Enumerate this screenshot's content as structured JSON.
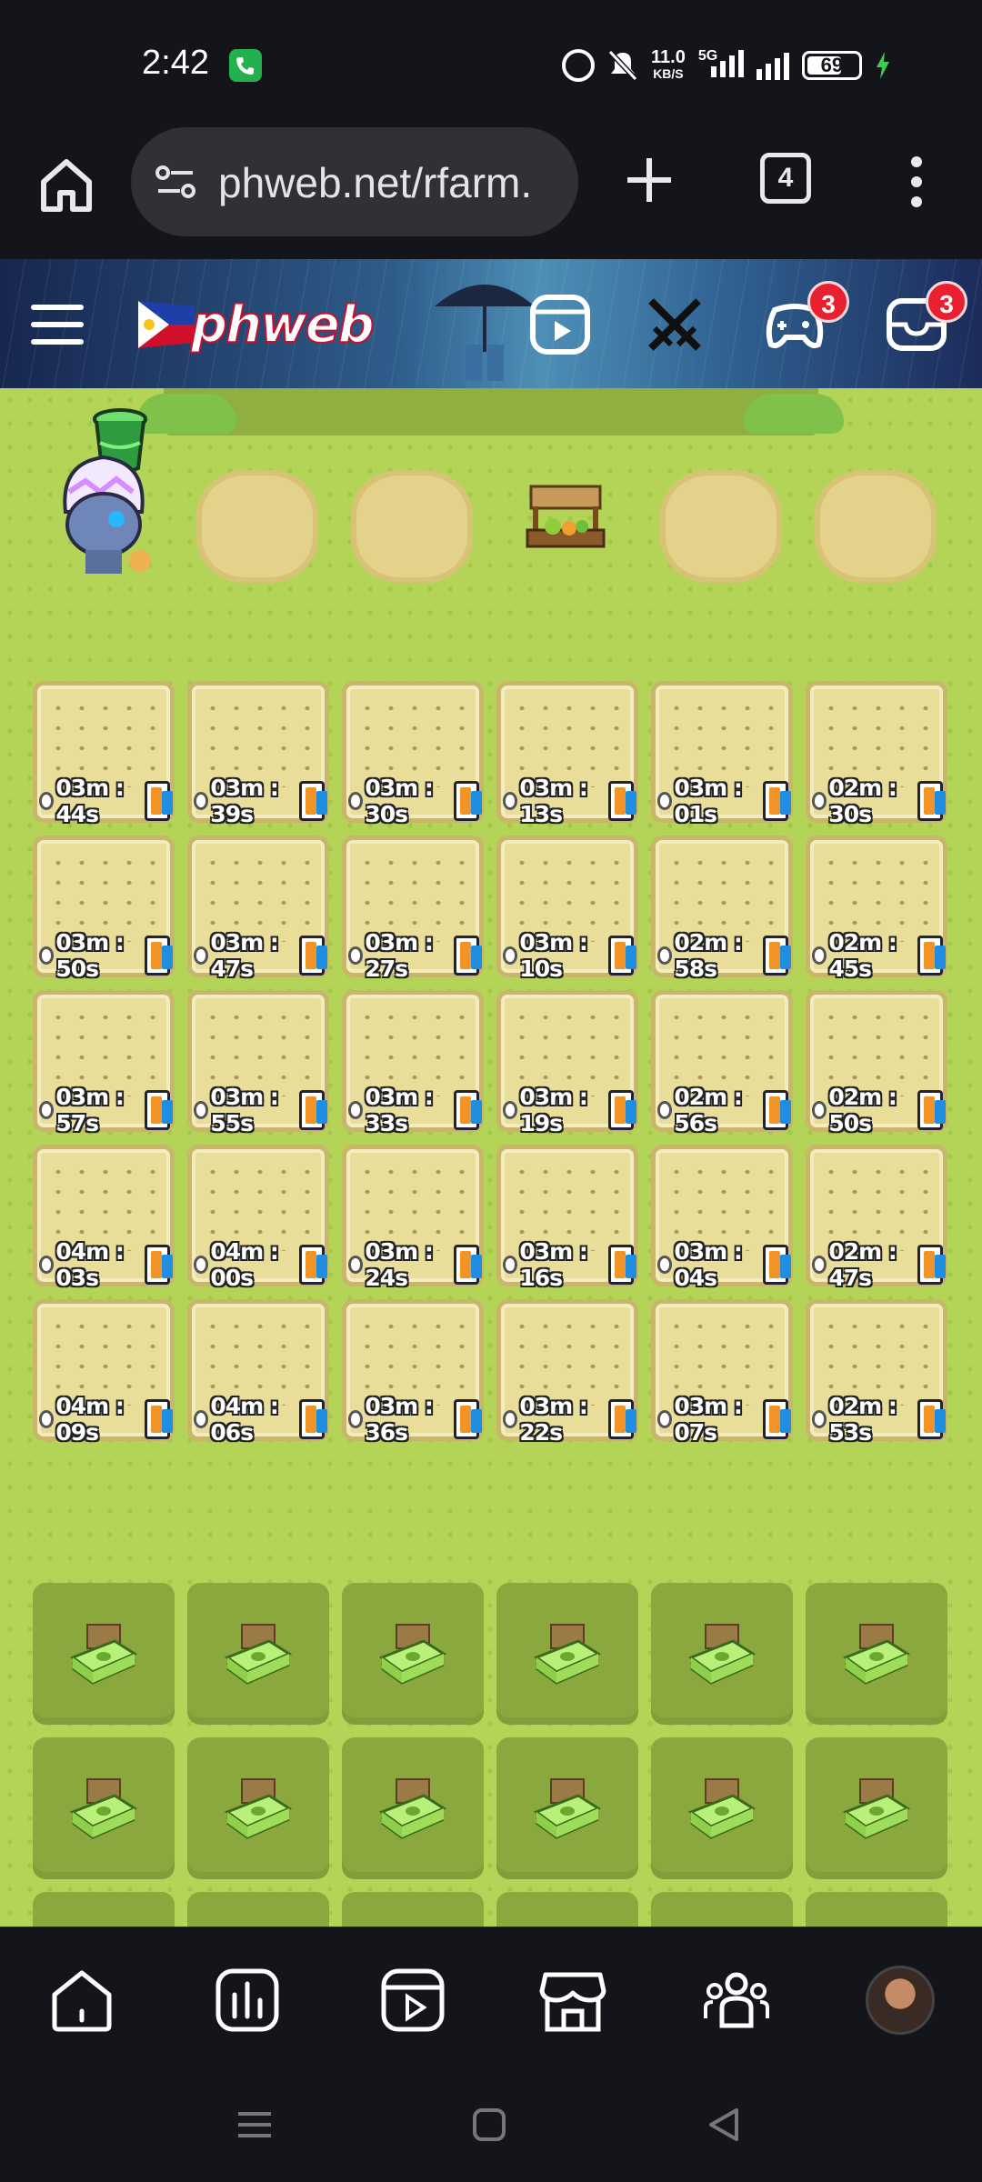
{
  "status_bar": {
    "time": "2:42",
    "net_speed_value": "11.0",
    "net_speed_unit": "KB/S",
    "network_type": "5G",
    "battery_level": "69",
    "battery_fraction": 0.69,
    "charging": true
  },
  "browser": {
    "url": "phweb.net/rfarm.",
    "tab_count": "4",
    "icons": [
      "home-icon",
      "site-settings-icon",
      "plus-icon",
      "tabs-icon",
      "more-vert-icon"
    ]
  },
  "site_header": {
    "logo_text": "phweb",
    "icons": [
      "hamburger-menu-icon",
      "video-reel-icon",
      "crossed-swords-icon",
      "gamepad-icon",
      "inbox-icon"
    ],
    "gamepad_badge": "3",
    "inbox_badge": "3"
  },
  "farm": {
    "active_plots": [
      {
        "timer": "03m : 44s"
      },
      {
        "timer": "03m : 39s"
      },
      {
        "timer": "03m : 30s"
      },
      {
        "timer": "03m : 13s"
      },
      {
        "timer": "03m : 01s"
      },
      {
        "timer": "02m : 30s"
      },
      {
        "timer": "03m : 50s"
      },
      {
        "timer": "03m : 47s"
      },
      {
        "timer": "03m : 27s"
      },
      {
        "timer": "03m : 10s"
      },
      {
        "timer": "02m : 58s"
      },
      {
        "timer": "02m : 45s"
      },
      {
        "timer": "03m : 57s"
      },
      {
        "timer": "03m : 55s"
      },
      {
        "timer": "03m : 33s"
      },
      {
        "timer": "03m : 19s"
      },
      {
        "timer": "02m : 56s"
      },
      {
        "timer": "02m : 50s"
      },
      {
        "timer": "04m : 03s"
      },
      {
        "timer": "04m : 00s"
      },
      {
        "timer": "03m : 24s"
      },
      {
        "timer": "03m : 16s"
      },
      {
        "timer": "03m : 04s"
      },
      {
        "timer": "02m : 47s"
      },
      {
        "timer": "04m : 09s"
      },
      {
        "timer": "04m : 06s"
      },
      {
        "timer": "03m : 36s"
      },
      {
        "timer": "03m : 22s"
      },
      {
        "timer": "03m : 07s"
      },
      {
        "timer": "02m : 53s"
      }
    ],
    "locked_plot_count": 18,
    "locked_plot_icon": "cash-stack-icon"
  },
  "site_nav": {
    "icons": [
      "home-icon",
      "chart-icon",
      "video-reel-icon",
      "store-icon",
      "community-icon",
      "profile-avatar"
    ]
  },
  "colors": {
    "grass": "#b2d356",
    "plot_soil": "#e9dd9a",
    "locked_plot": "#8ba83f",
    "badge": "#e8202f",
    "dark_ui": "#13151a"
  }
}
